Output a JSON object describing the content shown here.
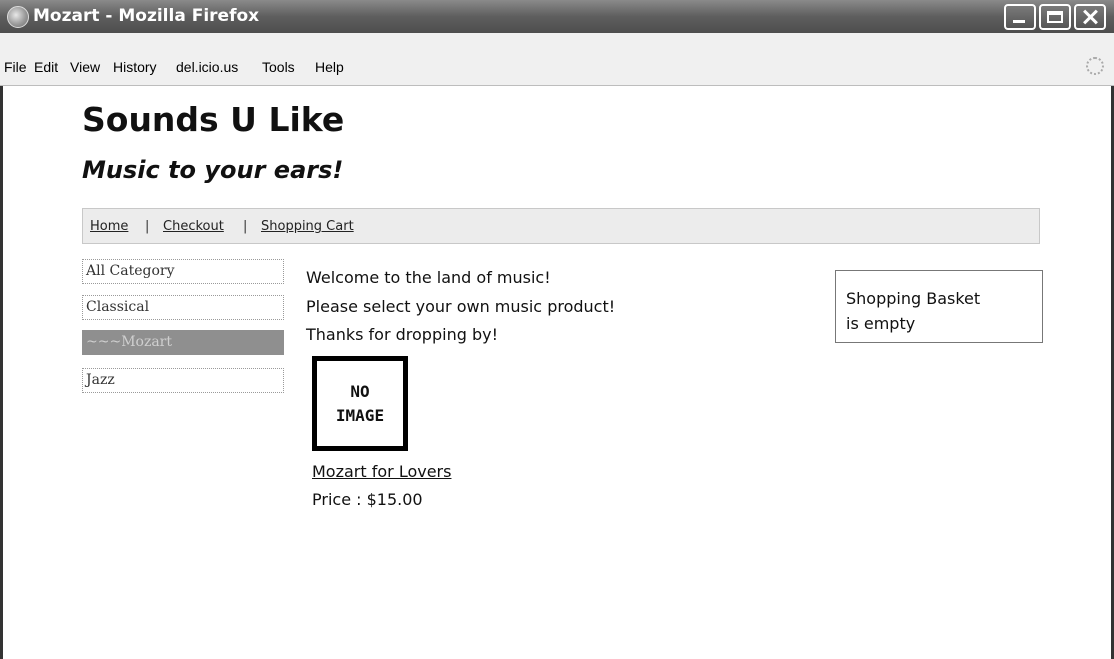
{
  "window": {
    "title": "Mozart - Mozilla Firefox",
    "icon": "firefox-icon"
  },
  "menubar": {
    "items": [
      "File",
      "Edit",
      "View",
      "History",
      "del.icio.us",
      "Tools",
      "Help"
    ]
  },
  "site": {
    "title": "Sounds U Like",
    "tagline": "Music to your ears!"
  },
  "nav": {
    "links": [
      "Home",
      "Checkout",
      "Shopping Cart"
    ],
    "separator": "|"
  },
  "categories": {
    "items": [
      "All Category",
      "Classical",
      "~~~Mozart",
      "Jazz"
    ],
    "selected": "~~~Mozart"
  },
  "welcome": {
    "lines": [
      "Welcome to the land of music!",
      "Please select your own music product!",
      "Thanks for dropping by!"
    ]
  },
  "product": {
    "image_placeholder_line1": "NO",
    "image_placeholder_line2": "IMAGE",
    "name": "Mozart for Lovers",
    "price": "Price : $15.00"
  },
  "basket": {
    "line1": "Shopping Basket",
    "line2": "is empty"
  }
}
